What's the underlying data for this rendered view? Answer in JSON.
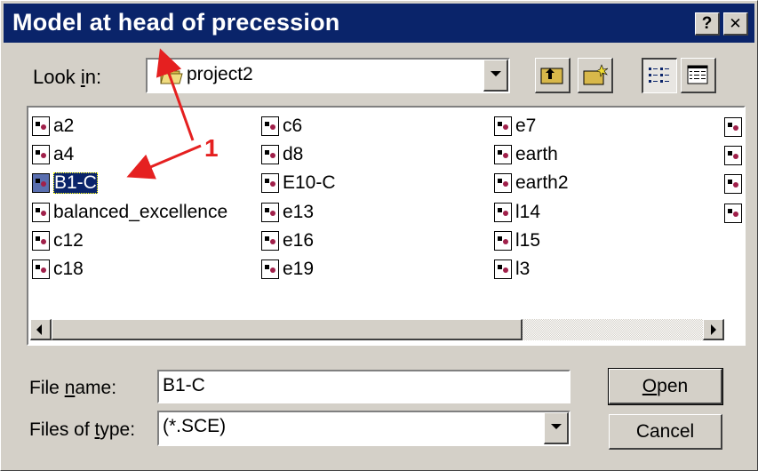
{
  "window": {
    "title": "Model at head of precession",
    "help_glyph": "?",
    "close_glyph": "✕"
  },
  "lookin": {
    "label_pre": "Look ",
    "label_accel": "i",
    "label_post": "n:",
    "value": "project2"
  },
  "files": [
    {
      "name": "a2",
      "selected": false
    },
    {
      "name": "a4",
      "selected": false
    },
    {
      "name": "B1-C",
      "selected": true
    },
    {
      "name": "balanced_excellence",
      "selected": false
    },
    {
      "name": "c12",
      "selected": false
    },
    {
      "name": "c18",
      "selected": false
    },
    {
      "name": "c6",
      "selected": false
    },
    {
      "name": "d8",
      "selected": false
    },
    {
      "name": "E10-C",
      "selected": false
    },
    {
      "name": "e13",
      "selected": false
    },
    {
      "name": "e16",
      "selected": false
    },
    {
      "name": "e19",
      "selected": false
    },
    {
      "name": "e7",
      "selected": false
    },
    {
      "name": "earth",
      "selected": false
    },
    {
      "name": "earth2",
      "selected": false
    },
    {
      "name": "l14",
      "selected": false
    },
    {
      "name": "l15",
      "selected": false
    },
    {
      "name": "l3",
      "selected": false
    }
  ],
  "filename": {
    "label_pre": "File ",
    "label_accel": "n",
    "label_post": "ame:",
    "value": "B1-C"
  },
  "filetype": {
    "label_pre": "Files of ",
    "label_accel": "t",
    "label_post": "ype:",
    "value": "(*.SCE)"
  },
  "buttons": {
    "open_accel": "O",
    "open_rest": "pen",
    "cancel": "Cancel"
  },
  "annotation": {
    "number": "1",
    "color": "#e52020"
  },
  "colors": {
    "titlebar": "#0a246a",
    "face": "#d4d0c8",
    "selection": "#0a246a"
  }
}
